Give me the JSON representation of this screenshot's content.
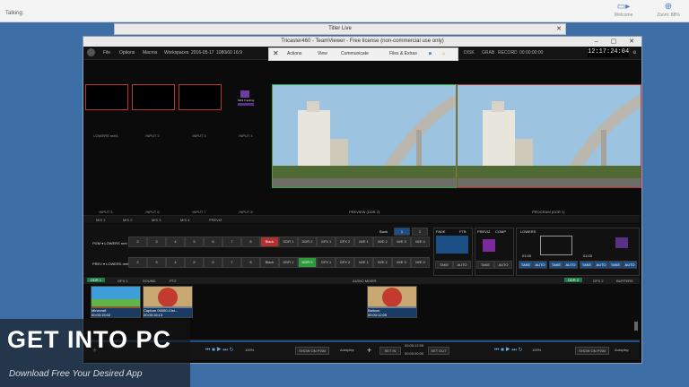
{
  "top": {
    "talking_label": "Talking:",
    "welcome_label": "Welcome",
    "zoom_label": "Zoom: 88%"
  },
  "titler_window": {
    "title": "Titler Live",
    "close": "✕"
  },
  "window": {
    "title": "Tricaster460 - TeamViewer - Free license (non-commercial use only)",
    "controls": "– ▢ ✕",
    "menu": [
      "File",
      "Options",
      "Macros",
      "Workspaces"
    ],
    "date": "2016-05-17",
    "resolution": "1080i60 16:9",
    "teamviewer": {
      "close": "✕",
      "actions": "Actions",
      "view": "View",
      "communicate": "Communicate",
      "files": "Files & Extras"
    },
    "status": [
      "DISK",
      "GRAB",
      "RECORD",
      "00:00:00:00"
    ],
    "clock": "12:17:24:04"
  },
  "inputs": [
    {
      "label": "LOWERS reel1"
    },
    {
      "label": "INPUT 2"
    },
    {
      "label": "INPUT 3"
    },
    {
      "label": "INPUT 4",
      "logo": "NRS Tracking"
    }
  ],
  "inputs_row2": [
    "INPUT 5",
    "INPUT 6",
    "INPUT 7",
    "INPUT 8"
  ],
  "monitors": {
    "preview": "PREVIEW (DDR 2)",
    "program": "PROGRAM (DDR 1)"
  },
  "mix_labels": [
    "MIX 1",
    "MIX 2",
    "MIX 3",
    "MIX 4",
    "PREVIZ"
  ],
  "switcher": {
    "bank_label": "Bank",
    "bank_buttons": [
      "1",
      "2"
    ],
    "pgm_label": "PGM ▾ LOWERS reel",
    "prev_label": "PREV ▾ LOWERS reel",
    "buttons": [
      "2",
      "3",
      "4",
      "5",
      "6",
      "7",
      "8",
      "Black",
      "DDR 1",
      "DDR 2",
      "GFX 1",
      "GFX 2",
      "M/E 1",
      "M/E 2",
      "M/E 3",
      "M/E 4"
    ],
    "fade": "FADE",
    "ftb": "FTB",
    "take": "TAKE",
    "auto": "AUTO",
    "previz": "PREVIZ",
    "comp": "COMP",
    "lowers": "LOWERS",
    "time": "01:00"
  },
  "media": {
    "tabs_left": [
      "DDR 1",
      "GFX 1",
      "SOUND",
      "PTZ"
    ],
    "audio_label": "AUDIO MIXER",
    "tabs_right": [
      "DDR 2",
      "GFX 2",
      "BUFFERS"
    ],
    "clips": [
      {
        "name": "Minecraft",
        "tc": "00:00:15:02"
      },
      {
        "name": "Capture 00000-Clst...",
        "tc": "00:00:16:13"
      },
      {
        "name": "Balloon",
        "tc": "00:00:12:05"
      }
    ]
  },
  "transport": {
    "zoom": "100%",
    "show_on_pgm": "SHOW ON PGM",
    "autoplay": "Autoplay",
    "set_in": "SET IN",
    "set_out": "SET OUT",
    "duration": "00:00:12:05",
    "position": "00:00:00:00"
  },
  "watermark": {
    "title": "GET INTO PC",
    "subtitle": "Download Free Your Desired App"
  }
}
